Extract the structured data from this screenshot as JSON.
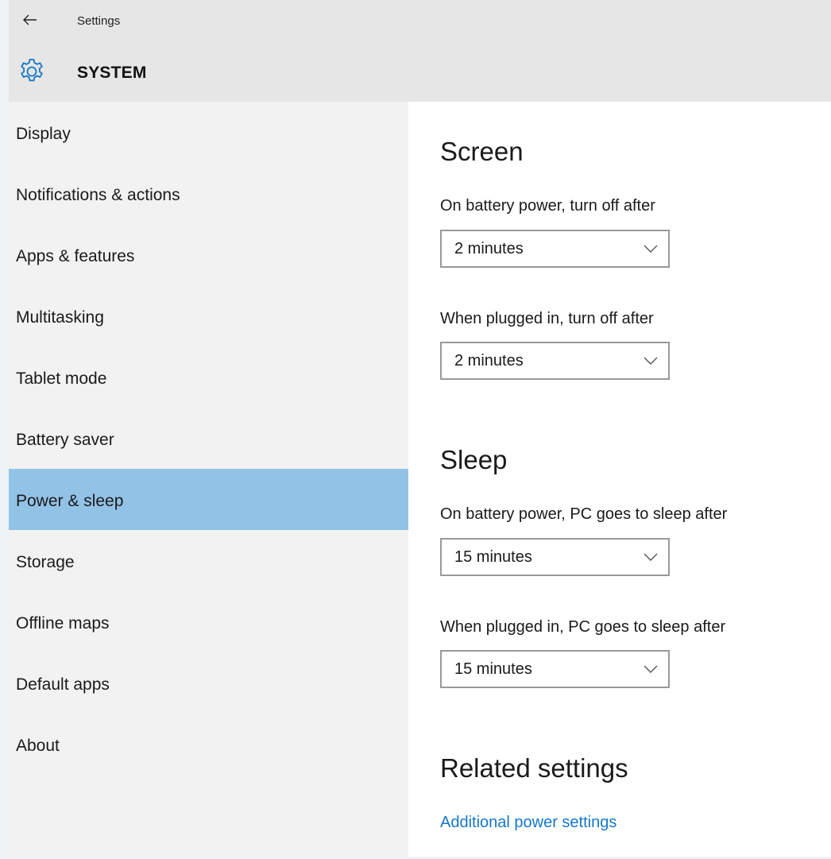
{
  "window": {
    "app_title": "Settings",
    "section": "SYSTEM"
  },
  "sidebar": {
    "items": [
      {
        "label": "Display"
      },
      {
        "label": "Notifications & actions"
      },
      {
        "label": "Apps & features"
      },
      {
        "label": "Multitasking"
      },
      {
        "label": "Tablet mode"
      },
      {
        "label": "Battery saver"
      },
      {
        "label": "Power & sleep",
        "selected": true
      },
      {
        "label": "Storage"
      },
      {
        "label": "Offline maps"
      },
      {
        "label": "Default apps"
      },
      {
        "label": "About"
      }
    ]
  },
  "content": {
    "screen": {
      "heading": "Screen",
      "battery_label": "On battery power, turn off after",
      "battery_value": "2 minutes",
      "plugged_label": "When plugged in, turn off after",
      "plugged_value": "2 minutes"
    },
    "sleep": {
      "heading": "Sleep",
      "battery_label": "On battery power, PC goes to sleep after",
      "battery_value": "15 minutes",
      "plugged_label": "When plugged in, PC goes to sleep after",
      "plugged_value": "15 minutes"
    },
    "related": {
      "heading": "Related settings",
      "link": "Additional power settings"
    }
  },
  "colors": {
    "selected_bg": "#93c2e7",
    "link": "#1677c8",
    "gear_icon": "#1677c8"
  },
  "icons": {
    "back": "back-arrow-icon",
    "settings": "gear-icon",
    "dropdown": "chevron-down-icon"
  }
}
